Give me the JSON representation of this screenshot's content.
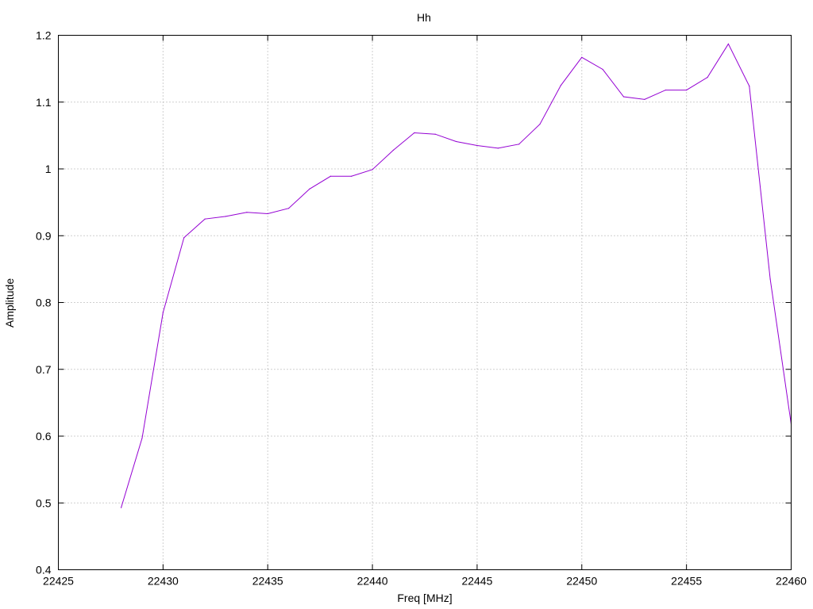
{
  "chart_data": {
    "type": "line",
    "title": "Hh",
    "xlabel": "Freq [MHz]",
    "ylabel": "Amplitude",
    "xlim": [
      22425,
      22460
    ],
    "ylim": [
      0.4,
      1.2
    ],
    "grid": true,
    "x_ticks": [
      "22425",
      "22430",
      "22435",
      "22440",
      "22445",
      "22450",
      "22455",
      "22460"
    ],
    "y_ticks": [
      "0.4",
      "0.5",
      "0.6",
      "0.7",
      "0.8",
      "0.9",
      "1",
      "1.1",
      "1.2"
    ],
    "series": [
      {
        "color": "#9400d3",
        "x": [
          22428,
          22429,
          22430,
          22431,
          22432,
          22433,
          22434,
          22435,
          22436,
          22437,
          22438,
          22439,
          22440,
          22441,
          22442,
          22443,
          22444,
          22445,
          22446,
          22447,
          22448,
          22449,
          22450,
          22451,
          22452,
          22453,
          22454,
          22455,
          22456,
          22457,
          22458,
          22459,
          22460
        ],
        "y": [
          0.493,
          0.597,
          0.785,
          0.897,
          0.925,
          0.929,
          0.935,
          0.933,
          0.941,
          0.97,
          0.989,
          0.989,
          0.999,
          1.028,
          1.054,
          1.052,
          1.041,
          1.035,
          1.031,
          1.037,
          1.067,
          1.125,
          1.167,
          1.149,
          1.108,
          1.104,
          1.118,
          1.118,
          1.137,
          1.187,
          1.124,
          0.835,
          0.618
        ]
      }
    ]
  }
}
